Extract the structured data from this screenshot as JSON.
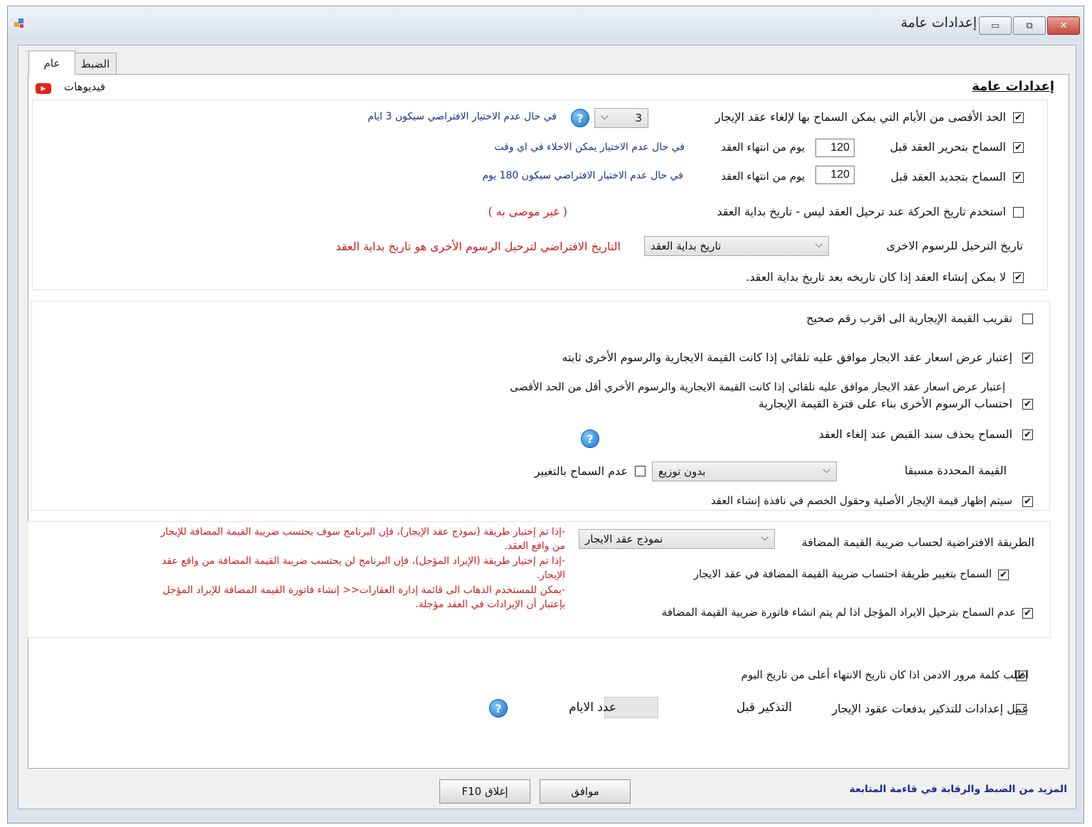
{
  "window": {
    "title": "إعدادات عامة",
    "minimize_glyph": "▭",
    "maximize_glyph": "⧉",
    "close_glyph": "✕"
  },
  "tabs": [
    {
      "label": "عام",
      "active": true
    },
    {
      "label": "الضبط",
      "active": false
    }
  ],
  "section_title": "إعدادات عامة",
  "videos_label": "فيديوهات",
  "group1": {
    "max_cancel_days": {
      "checked": true,
      "label": "الحد الأقصى من الأيام التي يمكن السماح بها لإلغاء عقد الإيجار",
      "value": "3",
      "note": "في حال عدم الاختيار الافتراضي سيكون 3 ايام"
    },
    "allow_edit": {
      "checked": true,
      "label": "السماح بتحرير العقد قبل",
      "value": "120",
      "suffix": "يوم من انتهاء العقد",
      "note": "في حال عدم الاختيار يمكن الاخلاء في اي وقت"
    },
    "allow_renew": {
      "checked": true,
      "label": "السماح بتجديد العقد قبل",
      "value": "120",
      "suffix": "يوم من انتهاء العقد",
      "note": "في حال عدم الاختيار الافتراضي سيكون 180 يوم"
    },
    "use_movement_date": {
      "checked": false,
      "label": "استخدم تاريخ الحركة عند ترحيل العقد ليس - تاريخ بداية العقد",
      "note": "( غير موصى به )"
    },
    "posting_date": {
      "label": "تاريخ الترحيل للرسوم الاخرى",
      "value": "تاريخ بداية العقد",
      "note": "التاريخ الافتراضي لترحيل الرسوم الأخرى هو تاريخ بداية العقد"
    },
    "no_create_after": {
      "checked": true,
      "label": "لا يمكن إنشاء العقد إذا كان تاريخه بعد تاريخ بداية العقد."
    }
  },
  "group2": {
    "round_rent": {
      "checked": false,
      "label": "تقريب القيمة الإيجارية الى اقرب رقم صحيح"
    },
    "auto_accept_fixed": {
      "checked": true,
      "label": "إعتبار عرض اسعار عقد الايجار موافق عليه تلقائي  إذا كانت القيمة الايجارية والرسوم الأخرى ثابته"
    },
    "auto_accept_less": {
      "label": "إعتبار عرض اسعار عقد الايجار موافق عليه تلقائي  إذا كانت القيمة الايجارية والرسوم الأخري أقل من الحد الأقصى"
    },
    "calc_fees": {
      "checked": true,
      "label": "احتساب الرسوم الأخرى بناء على فترة القيمة الإيجارية"
    },
    "allow_delete_receipt": {
      "checked": true,
      "label": "السماح بحذف سند القبض عند إلغاء العقد"
    },
    "preset_value": {
      "label": "القيمة المحددة مسبقا",
      "value": "بدون توزيع",
      "no_change_checked": false,
      "no_change_label": "عدم السماح بالتغيير"
    },
    "show_original": {
      "checked": true,
      "label": "سيتم إظهار قيمة الإيجار الأصلية وحقول الخصم في نافذة إنشاء العقد"
    }
  },
  "group3": {
    "vat_method": {
      "label": "الطريقة  الافتراضية لحساب ضريبة القيمة المضافة",
      "value": "نموذج عقد الايجار"
    },
    "allow_change_vat": {
      "checked": true,
      "label": "السماح بتغيير طريقة احتساب ضريبة القيمة المضافة في عقد الايجار"
    },
    "no_post_deferred": {
      "checked": true,
      "label": "عدم السماح بترحيل الايراد المؤجل اذا لم يتم انشاء فاتورة ضريبة القيمة المضافة"
    },
    "notes": [
      "-إذا تم إختيار طريقة (نموذج عقد الإيجار)، فإن البرنامج سوف يحتسب ضريبة القيمة المضافة للإيجار",
      "من  واقع العقد.",
      "-إذا تم إختيار طريقة (الإيراد المؤجل)، فإن البرنامج لن يحتسب ضريبة القيمة المضافة من واقع عقد",
      "الإيجار.",
      "-يمكن للمستخدم الذهاب الى قائمة إدارة العقارات<<  إنشاء فاتورة القيمة المضافة للإيراد المؤجل",
      "بإعتبار  أن الإيرادات في العقد مؤجلة."
    ]
  },
  "group4": {
    "admin_password": {
      "checked": true,
      "label": "اطلب كلمة مرور الادمن اذا كان تاريخ الانتهاء أعلى من تاريخ اليوم"
    },
    "reminder": {
      "checked": false,
      "label": "عمل إعدادات للتذكير بدفعات عقود الإيجار",
      "before_label": "التذكير قبل",
      "days_label": "عدد الايام",
      "days_value": ""
    }
  },
  "footer": {
    "link": "المزيد من الضبط والرقابة في قاءمة المتابعة",
    "ok_button": "موافق",
    "close_button": "إغلاق F10"
  },
  "help_glyph": "?",
  "check_glyph": "✔"
}
